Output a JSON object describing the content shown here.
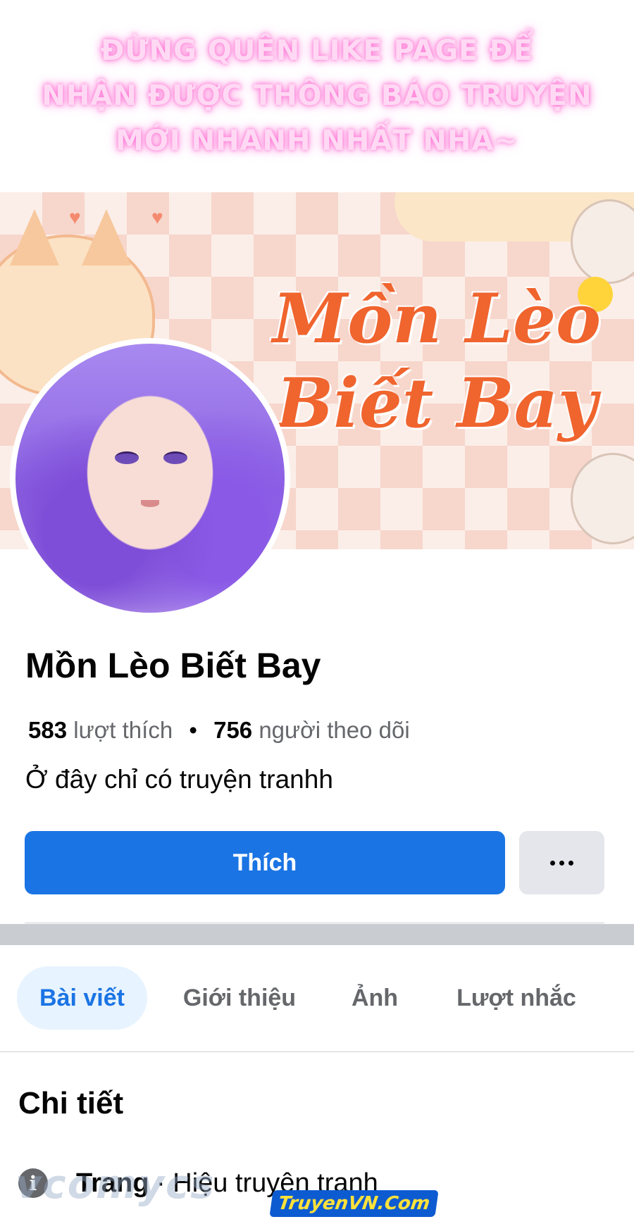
{
  "promo": {
    "lines": [
      "ĐỪNG QUÊN LIKE PAGE ĐỂ",
      "NHẬN ĐƯỢC THÔNG BÁO TRUYỆN",
      "MỚI NHANH NHẤT NHA~"
    ],
    "text_color": "#ffd9f4",
    "glow_color": "#ff6fd2"
  },
  "cover": {
    "title_line1": "Mồn Lèo",
    "title_line2": "Biết Bay",
    "title_color": "#f0642e"
  },
  "profile": {
    "page_name": "Mồn Lèo Biết Bay",
    "likes_count": "583",
    "likes_label": "lượt thích",
    "followers_count": "756",
    "followers_label": "người theo dõi",
    "bio": "Ở đây chỉ có truyện tranhh"
  },
  "actions": {
    "like_label": "Thích",
    "like_color": "#1b74e4",
    "more_icon": "more-dots-icon"
  },
  "tabs": [
    {
      "label": "Bài viết",
      "active": true
    },
    {
      "label": "Giới thiệu",
      "active": false
    },
    {
      "label": "Ảnh",
      "active": false
    },
    {
      "label": "Lượt nhắc",
      "active": false
    }
  ],
  "details": {
    "title": "Chi tiết",
    "rows": [
      {
        "icon": "info-icon",
        "label": "Trang",
        "value": "Hiệu truyện tranh"
      }
    ]
  },
  "watermarks": {
    "left": "vcomycs",
    "right": "TruyenVN.Com"
  }
}
